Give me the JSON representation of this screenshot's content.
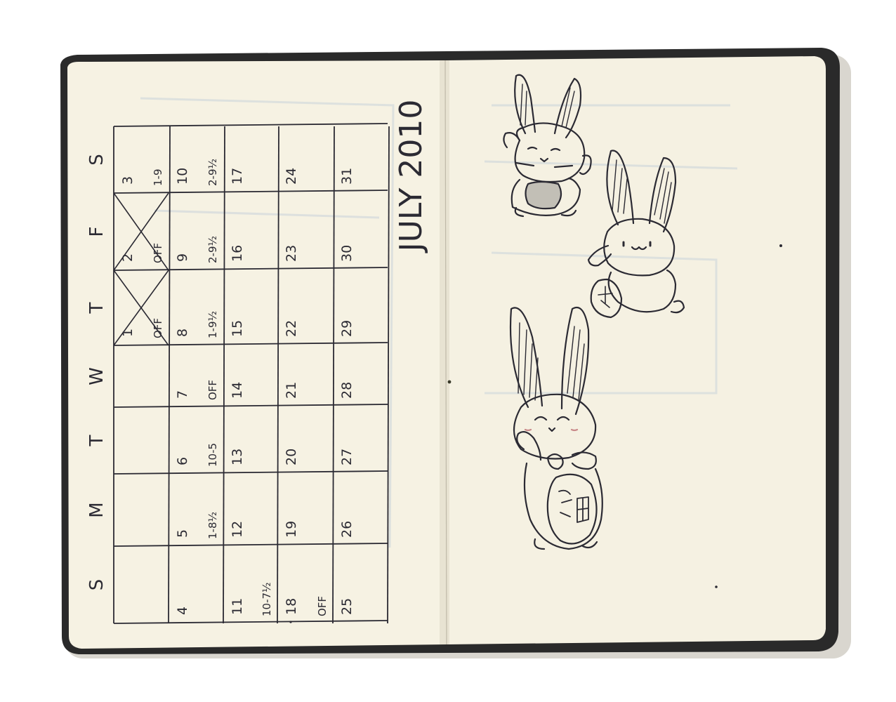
{
  "calendar": {
    "month_title": "JULY 2010",
    "weekday_headers": [
      "S",
      "M",
      "T",
      "W",
      "T",
      "F",
      "S"
    ],
    "weeks": [
      [
        {
          "day": "",
          "shift": ""
        },
        {
          "day": "",
          "shift": ""
        },
        {
          "day": "",
          "shift": ""
        },
        {
          "day": "",
          "shift": ""
        },
        {
          "day": "1",
          "shift": "OFF"
        },
        {
          "day": "2",
          "shift": "OFF"
        },
        {
          "day": "3",
          "shift": "1-9"
        }
      ],
      [
        {
          "day": "4",
          "shift": ""
        },
        {
          "day": "5",
          "shift": "1-8½"
        },
        {
          "day": "6",
          "shift": "10-5"
        },
        {
          "day": "7",
          "shift": "OFF"
        },
        {
          "day": "8",
          "shift": "1-9½"
        },
        {
          "day": "9",
          "shift": "2-9½"
        },
        {
          "day": "10",
          "shift": "2-9½"
        }
      ],
      [
        {
          "day": "11",
          "shift": "10-7½"
        },
        {
          "day": "12",
          "shift": ""
        },
        {
          "day": "13",
          "shift": ""
        },
        {
          "day": "14",
          "shift": ""
        },
        {
          "day": "15",
          "shift": ""
        },
        {
          "day": "16",
          "shift": ""
        },
        {
          "day": "17",
          "shift": ""
        }
      ],
      [
        {
          "day": "18",
          "shift": "OFF"
        },
        {
          "day": "19",
          "shift": ""
        },
        {
          "day": "20",
          "shift": ""
        },
        {
          "day": "21",
          "shift": ""
        },
        {
          "day": "22",
          "shift": ""
        },
        {
          "day": "23",
          "shift": ""
        },
        {
          "day": "24",
          "shift": ""
        }
      ],
      [
        {
          "day": "25",
          "shift": ""
        },
        {
          "day": "26",
          "shift": ""
        },
        {
          "day": "27",
          "shift": ""
        },
        {
          "day": "28",
          "shift": ""
        },
        {
          "day": "29",
          "shift": ""
        },
        {
          "day": "30",
          "shift": ""
        },
        {
          "day": "31",
          "shift": ""
        }
      ]
    ]
  },
  "sketch_page": {
    "subject": "three maneki-neko style rabbits holding coins"
  },
  "colors": {
    "paper": "#f6f2e3",
    "ink": "#2b2a33",
    "cover": "#2a2a2a"
  }
}
